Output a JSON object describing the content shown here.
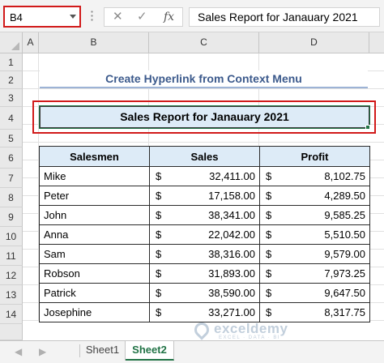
{
  "formula_bar": {
    "name_box": "B4",
    "cancel_icon": "✕",
    "enter_icon": "✓",
    "fx_icon": "fx",
    "content": "Sales Report for Janauary 2021"
  },
  "columns": [
    "A",
    "B",
    "C",
    "D"
  ],
  "rows": [
    "1",
    "2",
    "3",
    "4",
    "5",
    "6",
    "7",
    "8",
    "9",
    "10",
    "11",
    "12",
    "13",
    "14"
  ],
  "sheet": {
    "title": "Create Hyperlink from Context Menu",
    "selected_cell_text": "Sales Report for Janauary 2021"
  },
  "table": {
    "headers": [
      "Salesmen",
      "Sales",
      "Profit"
    ],
    "currency_symbol": "$",
    "rows": [
      {
        "name": "Mike",
        "sales": "32,411.00",
        "profit": "8,102.75"
      },
      {
        "name": "Peter",
        "sales": "17,158.00",
        "profit": "4,289.50"
      },
      {
        "name": "John",
        "sales": "38,341.00",
        "profit": "9,585.25"
      },
      {
        "name": "Anna",
        "sales": "22,042.00",
        "profit": "5,510.50"
      },
      {
        "name": "Sam",
        "sales": "38,316.00",
        "profit": "9,579.00"
      },
      {
        "name": "Robson",
        "sales": "31,893.00",
        "profit": "7,973.25"
      },
      {
        "name": "Patrick",
        "sales": "38,590.00",
        "profit": "9,647.50"
      },
      {
        "name": "Josephine",
        "sales": "33,271.00",
        "profit": "8,317.75"
      }
    ]
  },
  "tabs": {
    "prev_icon": "◀",
    "next_icon": "▶",
    "items": [
      {
        "label": "Sheet1",
        "active": false
      },
      {
        "label": "Sheet2",
        "active": true
      }
    ]
  },
  "watermark": {
    "name": "exceldemy",
    "tagline": "EXCEL · DATA · BI"
  },
  "colors": {
    "selection_border": "#d11a1a",
    "header_fill": "#ddebf7",
    "title_color": "#3c5a8c",
    "excel_green": "#217346"
  }
}
